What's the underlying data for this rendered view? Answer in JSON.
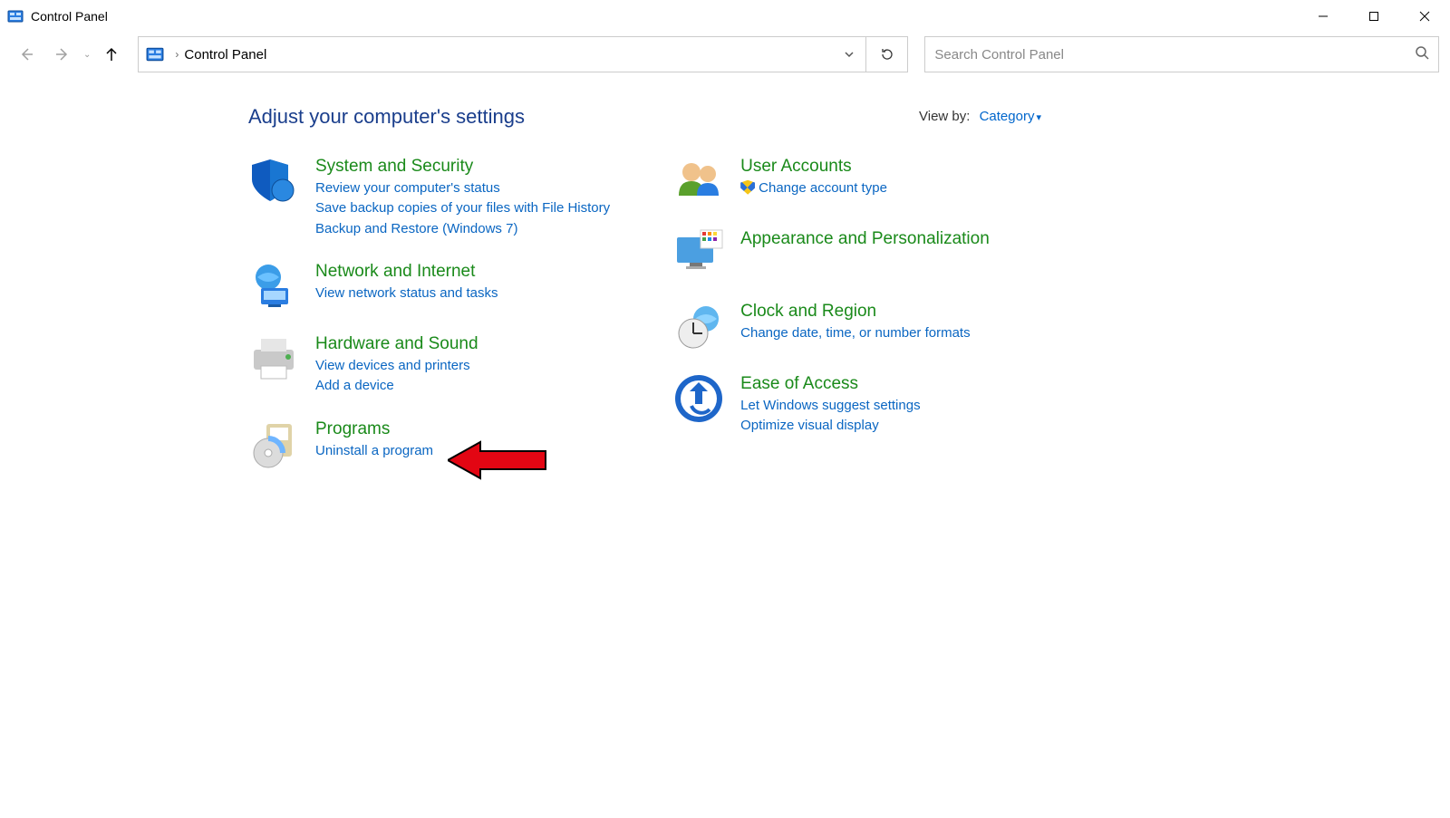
{
  "window": {
    "title": "Control Panel"
  },
  "breadcrumb": {
    "location": "Control Panel"
  },
  "search": {
    "placeholder": "Search Control Panel"
  },
  "heading": "Adjust your computer's settings",
  "viewby": {
    "label": "View by:",
    "value": "Category"
  },
  "col1": [
    {
      "title": "System and Security",
      "links": [
        {
          "text": "Review your computer's status"
        },
        {
          "text": "Save backup copies of your files with File History"
        },
        {
          "text": "Backup and Restore (Windows 7)"
        }
      ]
    },
    {
      "title": "Network and Internet",
      "links": [
        {
          "text": "View network status and tasks"
        }
      ]
    },
    {
      "title": "Hardware and Sound",
      "links": [
        {
          "text": "View devices and printers"
        },
        {
          "text": "Add a device"
        }
      ]
    },
    {
      "title": "Programs",
      "links": [
        {
          "text": "Uninstall a program"
        }
      ]
    }
  ],
  "col2": [
    {
      "title": "User Accounts",
      "links": [
        {
          "text": "Change account type",
          "shield": true
        }
      ]
    },
    {
      "title": "Appearance and Personalization",
      "links": []
    },
    {
      "title": "Clock and Region",
      "links": [
        {
          "text": "Change date, time, or number formats"
        }
      ]
    },
    {
      "title": "Ease of Access",
      "links": [
        {
          "text": "Let Windows suggest settings"
        },
        {
          "text": "Optimize visual display"
        }
      ]
    }
  ]
}
